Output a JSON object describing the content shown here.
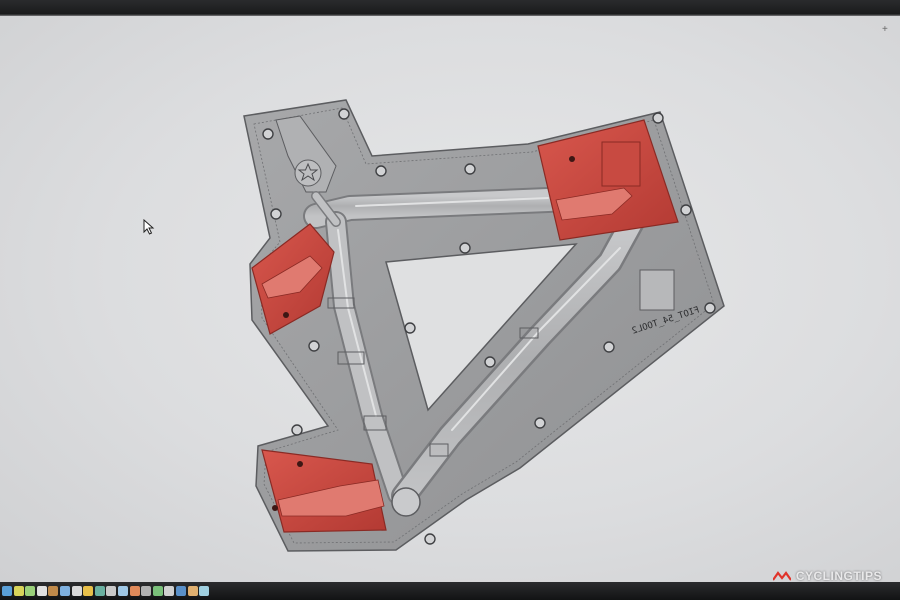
{
  "viewport": {
    "mold_label": "FIOT_54_TOOL2",
    "corner_marker": "+"
  },
  "watermark": {
    "text": "CYCLINGTIPS"
  },
  "taskbar": {
    "icons": [
      "toolbar-icon-1",
      "toolbar-icon-2",
      "toolbar-icon-3",
      "toolbar-icon-4",
      "toolbar-icon-5",
      "toolbar-icon-6",
      "toolbar-icon-7",
      "toolbar-icon-8",
      "toolbar-icon-9",
      "toolbar-icon-10",
      "toolbar-icon-11",
      "toolbar-icon-12",
      "toolbar-icon-13",
      "toolbar-icon-14",
      "toolbar-icon-15",
      "toolbar-icon-16",
      "toolbar-icon-17",
      "toolbar-icon-18"
    ]
  },
  "colors": {
    "plate": "#9a9b9d",
    "plate_edge": "#5c5d60",
    "channel": "#b9babc",
    "insert": "#c94a42",
    "insert_dark": "#9c2f29",
    "background": "#dedfe0",
    "watermark_accent": "#e0342b"
  }
}
